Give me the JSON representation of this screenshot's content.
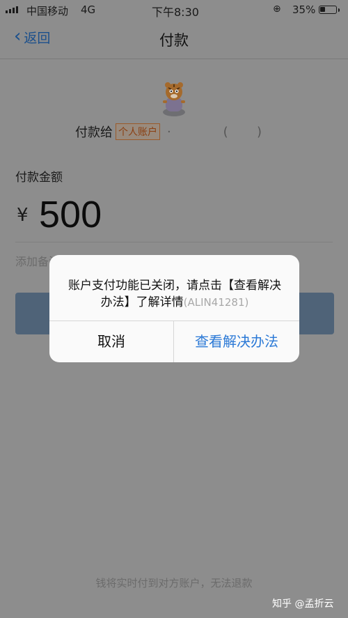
{
  "status_bar": {
    "carrier": "中国移动",
    "network": "4G",
    "time": "下午8:30",
    "battery_percent": "35%",
    "battery_level": 0.35,
    "icons": [
      "signal-icon",
      "orientation-lock-icon",
      "battery-icon"
    ]
  },
  "nav": {
    "back_label": "返回",
    "title": "付款"
  },
  "payee": {
    "prefix": "付款给",
    "tag": "个人账户",
    "masked_name": ")",
    "avatar": "tiger-avatar"
  },
  "amount": {
    "label": "付款金额",
    "currency": "¥",
    "value": "500"
  },
  "remark_placeholder": "添加备注",
  "footer_note": "钱将实时付到对方账户，无法退款",
  "watermark": "知乎 @孟折云",
  "dialog": {
    "message": "账户支付功能已关闭，请点击【查看解决办法】了解详情",
    "code": "(ALIN41281)",
    "cancel_label": "取消",
    "confirm_label": "查看解决办法"
  },
  "colors": {
    "link_blue": "#2b79d6",
    "dim_overlay": "#8d8d8d",
    "dialog_bg": "#fafafa"
  }
}
